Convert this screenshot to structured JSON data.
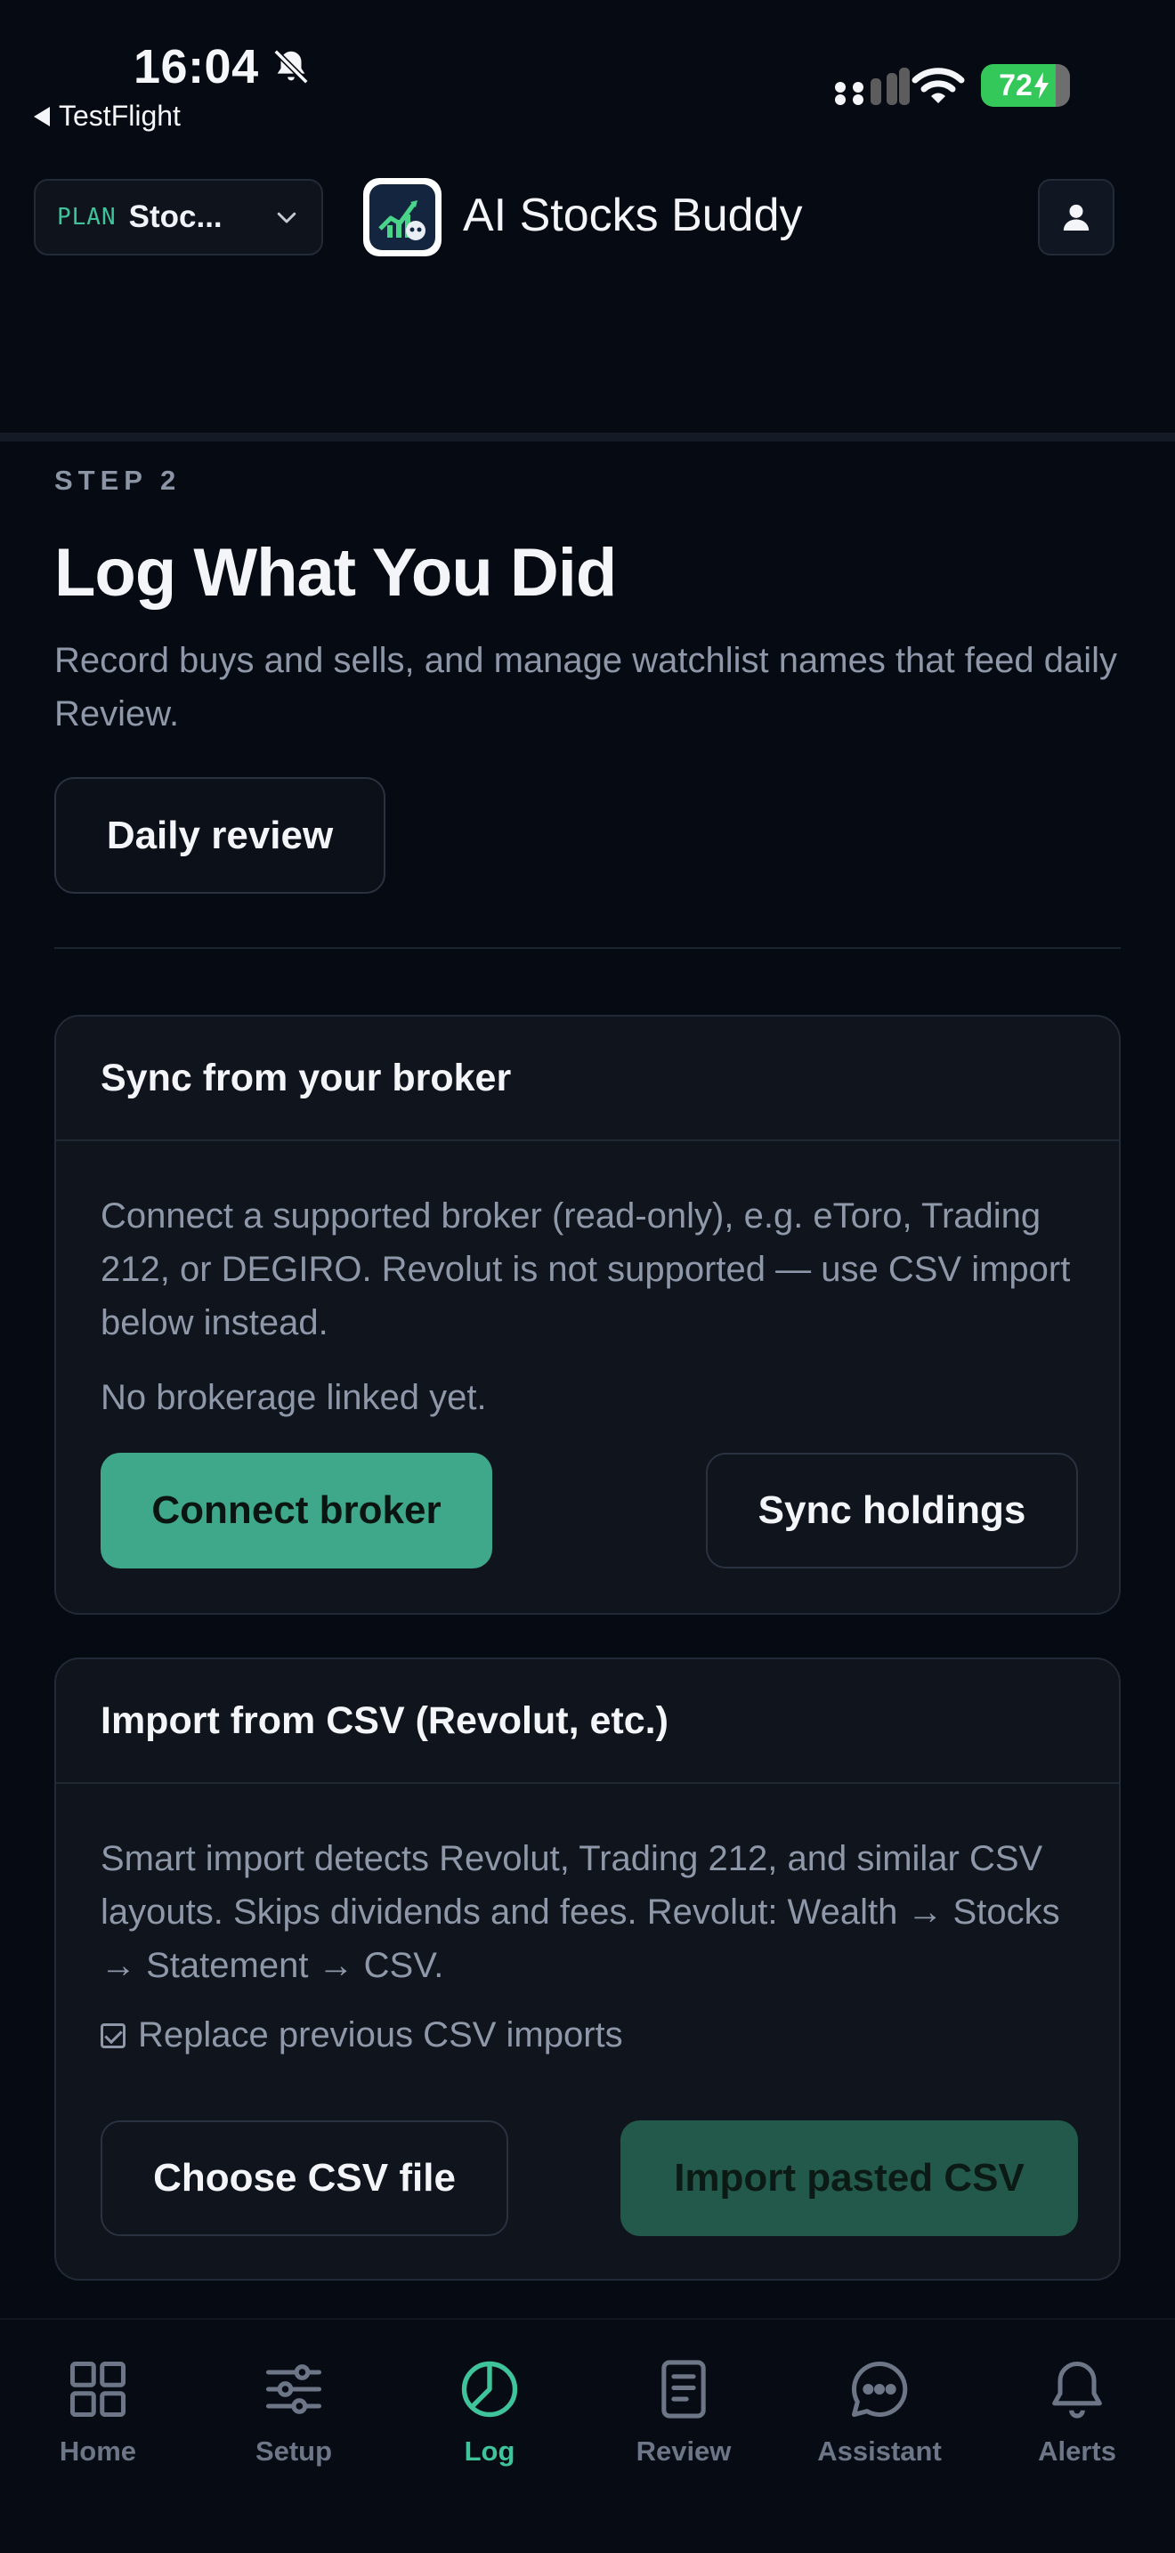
{
  "status_bar": {
    "time": "16:04",
    "back_app": "TestFlight",
    "battery": "72"
  },
  "header": {
    "plan_tag": "PLAN",
    "plan_name": "Stoc...",
    "app_title": "AI Stocks Buddy"
  },
  "main": {
    "step_label": "STEP 2",
    "title": "Log What You Did",
    "description": "Record buys and sells, and manage watchlist names that feed daily Review.",
    "daily_review_label": "Daily review"
  },
  "broker_card": {
    "title": "Sync from your broker",
    "description": "Connect a supported broker (read-only), e.g. eToro, Trading 212, or DEGIRO. Revolut is not supported — use CSV import below instead.",
    "status": "No brokerage linked yet.",
    "connect_label": "Connect broker",
    "sync_label": "Sync holdings"
  },
  "csv_card": {
    "title": "Import from CSV (Revolut, etc.)",
    "description": "Smart import detects Revolut, Trading 212, and similar CSV layouts. Skips dividends and fees. Revolut: Wealth → Stocks → Statement → CSV.",
    "replace_label": "Replace previous CSV imports",
    "replace_checked": true,
    "choose_label": "Choose CSV file",
    "import_label": "Import pasted CSV"
  },
  "bottom_nav": {
    "active": "Log",
    "items": [
      {
        "label": "Home",
        "icon": "grid-icon"
      },
      {
        "label": "Setup",
        "icon": "sliders-icon"
      },
      {
        "label": "Log",
        "icon": "pie-chart-icon"
      },
      {
        "label": "Review",
        "icon": "document-icon"
      },
      {
        "label": "Assistant",
        "icon": "chat-bubble-icon"
      },
      {
        "label": "Alerts",
        "icon": "bell-icon"
      }
    ]
  },
  "colors": {
    "background": "#060a12",
    "accent": "#3fc39a",
    "primary_button": "#3fa78a",
    "muted_text": "#8e98a8"
  }
}
